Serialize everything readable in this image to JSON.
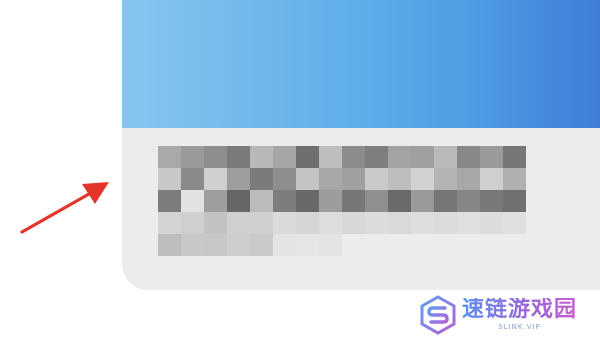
{
  "card": {
    "header_gradient": [
      "#86c6ee",
      "#62b0ea",
      "#4f9de3",
      "#3f7ed9"
    ],
    "body_color": "#ececec"
  },
  "mosaic": {
    "description_visible": false,
    "rows": [
      [
        "#a9a9a9",
        "#9a9a9a",
        "#8e8e8e",
        "#7a7a7a",
        "#b8b8b8",
        "#a6a6a6",
        "#6f6f6f",
        "#bdbdbd",
        "#8c8c8c",
        "#7e7e7e",
        "#a3a3a3",
        "#9f9f9f",
        "#b9b9b9",
        "#888888",
        "#9a9a9a",
        "#777777"
      ],
      [
        "#c8c8c8",
        "#8a8a8a",
        "#d0d0d0",
        "#9d9d9d",
        "#7b7b7b",
        "#8d8d8d",
        "#c4c4c4",
        "#a7a7a7",
        "#a0a0a0",
        "#c9c9c9",
        "#bdbdbd",
        "#d2d2d2",
        "#b3b3b3",
        "#a8a8a8",
        "#cfcfcf",
        "#b0b0b0"
      ],
      [
        "#7c7c7c",
        "#e2e2e2",
        "#9e9e9e",
        "#666666",
        "#bcbcbc",
        "#7d7d7d",
        "#696969",
        "#9c9c9c",
        "#777777",
        "#8f8f8f",
        "#6a6a6a",
        "#9a9a9a",
        "#767676",
        "#868686",
        "#797979",
        "#707070"
      ],
      [
        "#d4d4d4",
        "#cfcfcf",
        "#c2c2c2",
        "#cfcfcf",
        "#d0d0d0",
        "#dadada",
        "#d5d5d5",
        "#dddddd",
        "#d8d8d8",
        "#dcdcdc",
        "#d9d9d9",
        "#dedede",
        "#dbdbdb",
        "#e0e0e0",
        "#dcdcdc",
        "#e0e0e0"
      ],
      [
        "#bdbdbd",
        "#c8c8c8",
        "#c7c7c7",
        "#cdcdcd",
        "#c9c9c9",
        "#e4e4e4",
        "#e6e6e6",
        "#e4e4e4"
      ]
    ]
  },
  "annotation": {
    "arrow_color": "#e2362b"
  },
  "watermark": {
    "title": "速链游戏园",
    "subtitle": "SLINK.VIP",
    "logo_icon": "s-letter-logo-icon",
    "colors": [
      "#5a8ff0",
      "#9b62d9",
      "#c65fd0"
    ]
  }
}
